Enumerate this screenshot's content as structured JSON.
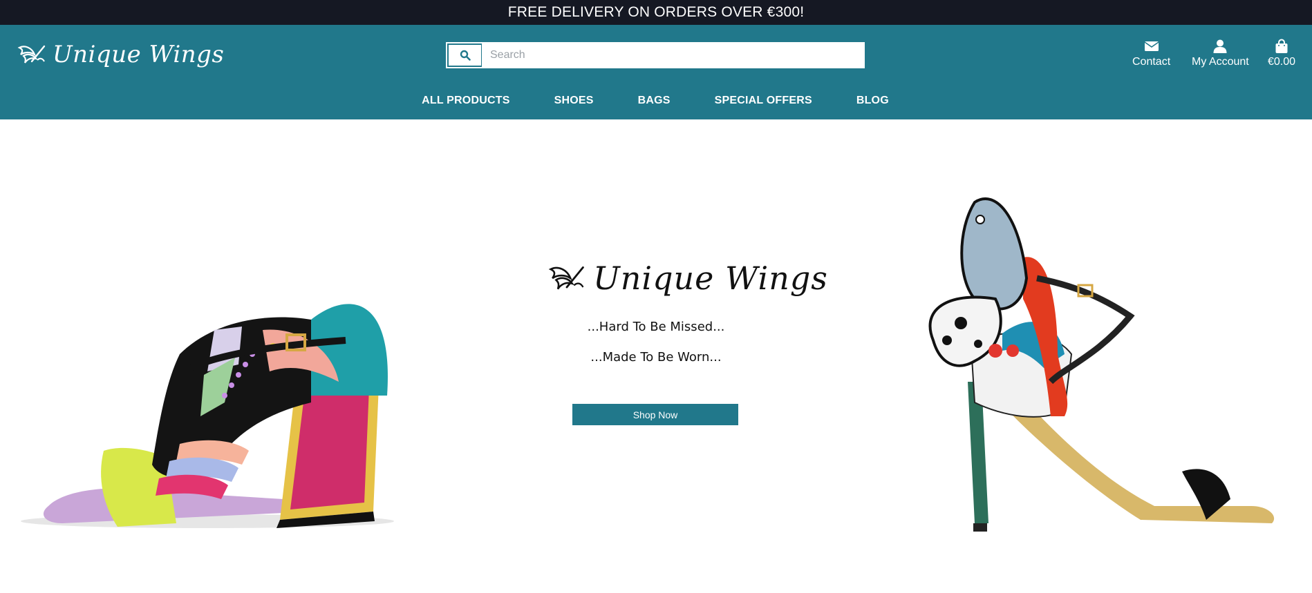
{
  "announcement": {
    "text": "FREE DELIVERY ON ORDERS OVER €300!"
  },
  "header": {
    "logo_text": "Unique Wings",
    "search": {
      "placeholder": "Search",
      "value": ""
    },
    "utilities": {
      "contact_label": "Contact",
      "account_label": "My Account",
      "bag_total": "€0.00"
    },
    "nav": [
      {
        "label": "ALL PRODUCTS"
      },
      {
        "label": "SHOES"
      },
      {
        "label": "BAGS"
      },
      {
        "label": "SPECIAL OFFERS"
      },
      {
        "label": "BLOG"
      }
    ]
  },
  "hero": {
    "logo_text": "Unique Wings",
    "tagline_1": "...Hard To Be Missed...",
    "tagline_2": "...Made To Be Worn...",
    "cta_label": "Shop Now"
  },
  "colors": {
    "topbar_bg": "#151823",
    "header_bg": "#21788b",
    "button_bg": "#21788b",
    "page_bg": "#ffffff"
  }
}
